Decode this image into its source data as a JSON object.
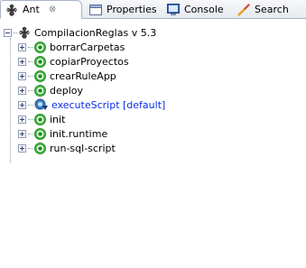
{
  "tabs": [
    {
      "label": "Ant",
      "icon": "ant-icon",
      "active": true,
      "close": "⊗"
    },
    {
      "label": "Properties",
      "icon": "properties-icon",
      "active": false
    },
    {
      "label": "Console",
      "icon": "console-icon",
      "active": false
    },
    {
      "label": "Search",
      "icon": "search-icon",
      "active": false
    }
  ],
  "tree": {
    "root": {
      "label": "CompilacionReglas v 5.3",
      "icon": "ant-buildfile-icon",
      "expanded": true
    },
    "targets": [
      {
        "label": "borrarCarpetas",
        "icon": "target-icon"
      },
      {
        "label": "copiarProyectos",
        "icon": "target-icon"
      },
      {
        "label": "crearRuleApp",
        "icon": "target-icon"
      },
      {
        "label": "deploy",
        "icon": "target-icon"
      },
      {
        "label": "executeScript [default]",
        "icon": "default-target-icon",
        "is_default": true
      },
      {
        "label": "init",
        "icon": "target-icon"
      },
      {
        "label": "init.runtime",
        "icon": "target-icon"
      },
      {
        "label": "run-sql-script",
        "icon": "target-icon"
      }
    ]
  },
  "colors": {
    "default_target_text": "#0b2ee8",
    "target_green": "#40b440",
    "tab_border": "#a9b3c2"
  }
}
